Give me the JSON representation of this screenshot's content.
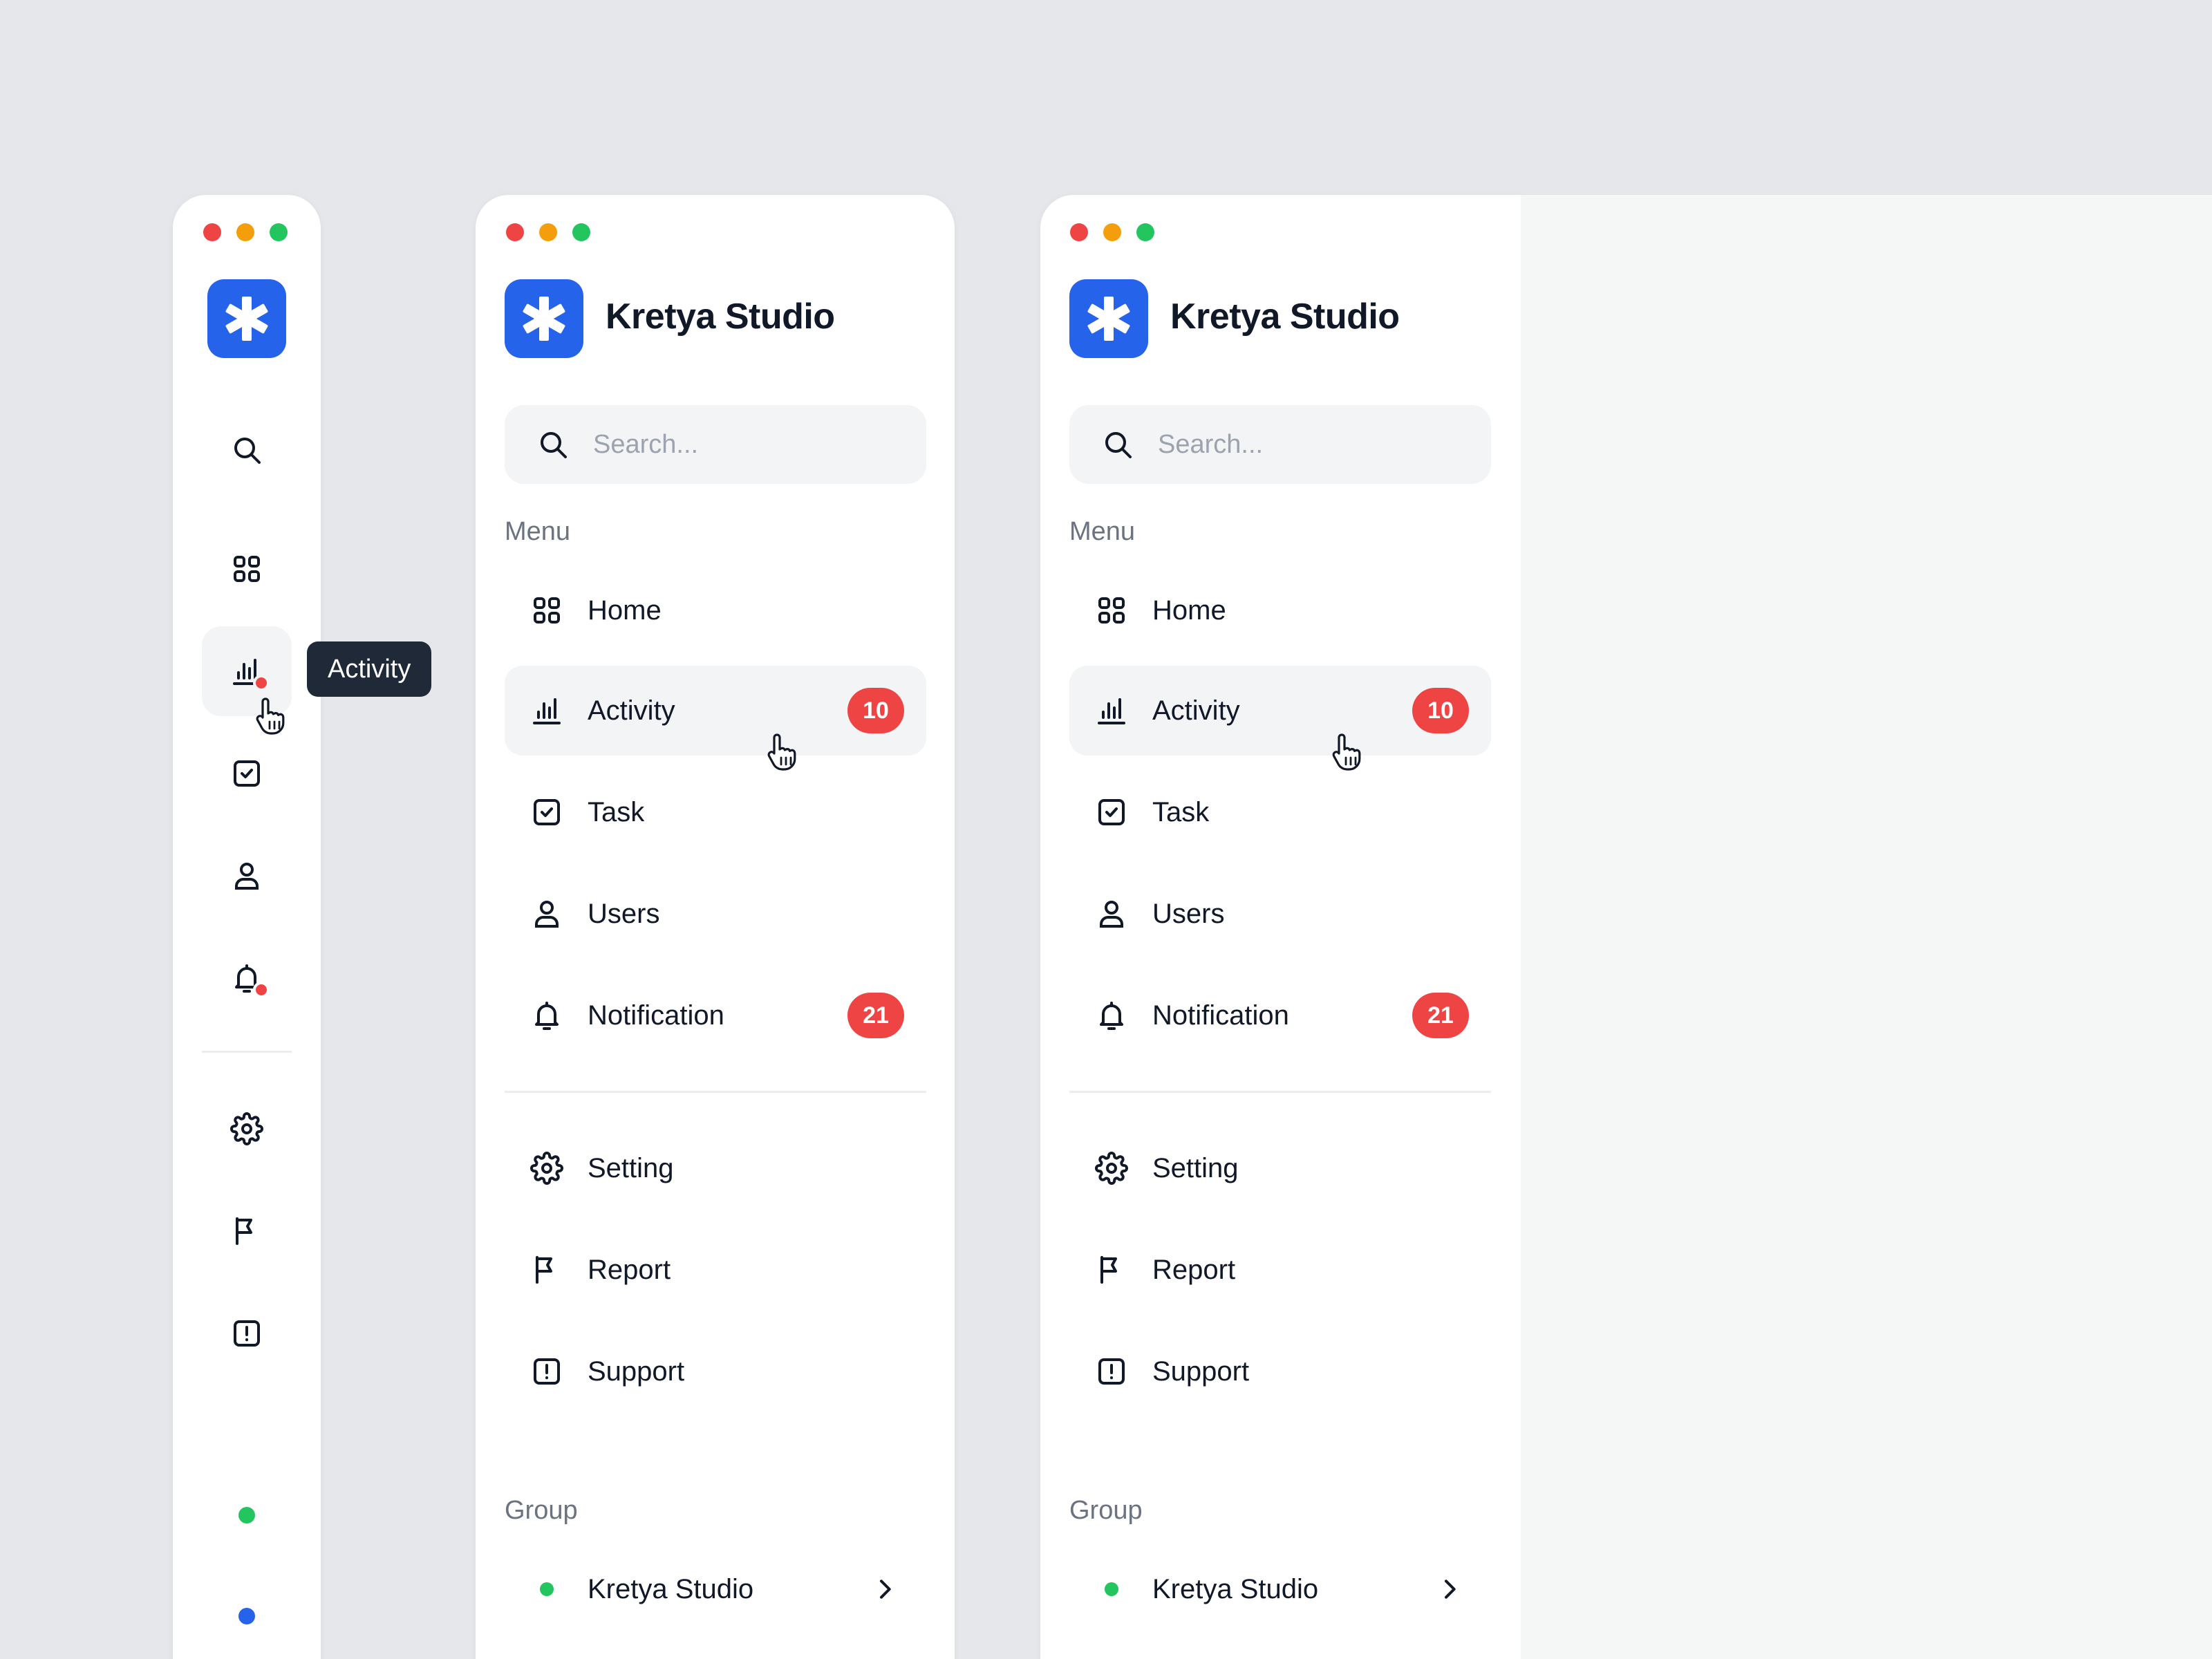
{
  "brand": {
    "name": "Kretya Studio",
    "color": "#2563eb",
    "icon": "asterisk-logo-icon"
  },
  "search": {
    "placeholder": "Search...",
    "value": ""
  },
  "menu": {
    "label": "Menu",
    "items": [
      {
        "label": "Home",
        "icon": "grid-icon"
      },
      {
        "label": "Activity",
        "icon": "bar-chart-icon",
        "badge": "10",
        "active": true
      },
      {
        "label": "Task",
        "icon": "check-square-icon"
      },
      {
        "label": "Users",
        "icon": "user-icon"
      },
      {
        "label": "Notification",
        "icon": "bell-icon",
        "badge": "21"
      }
    ]
  },
  "secondary": {
    "items": [
      {
        "label": "Setting",
        "icon": "gear-icon"
      },
      {
        "label": "Report",
        "icon": "flag-icon"
      },
      {
        "label": "Support",
        "icon": "alert-square-icon"
      }
    ]
  },
  "group": {
    "label": "Group",
    "items": [
      {
        "label": "Kretya Studio",
        "status_color": "#22c55e"
      }
    ]
  },
  "rail": {
    "tooltip": "Activity",
    "group_dots": [
      "#22c55e",
      "#2563eb"
    ]
  },
  "colors": {
    "badge": "#ef4444",
    "active_bg": "#f3f4f5",
    "window_red": "#ef4444",
    "window_yellow": "#f59e0b",
    "window_green": "#22c55e"
  }
}
